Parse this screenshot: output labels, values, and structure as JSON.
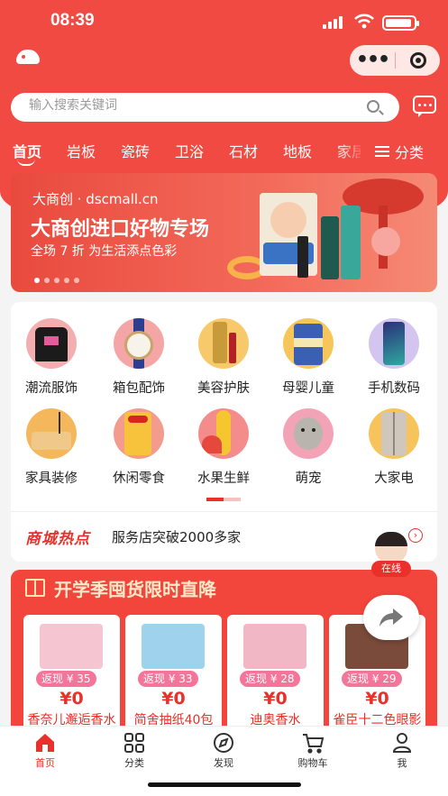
{
  "status_bar": {
    "time": "08:39"
  },
  "search": {
    "placeholder": "输入搜索关键词"
  },
  "tabs": [
    "首页",
    "岩板",
    "瓷砖",
    "卫浴",
    "石材",
    "地板",
    "家居"
  ],
  "category_button": "分类",
  "banner": {
    "brand": "大商创 · dscmall.cn",
    "title": "大商创进口好物专场",
    "subtitle": "全场 7 折 为生活添点色彩",
    "slides": 5,
    "active_slide": 1
  },
  "categories": [
    {
      "label": "潮流服饰",
      "icon": "tshirt-icon"
    },
    {
      "label": "箱包配饰",
      "icon": "watch-icon"
    },
    {
      "label": "美容护肤",
      "icon": "cosmetics-icon"
    },
    {
      "label": "母婴儿童",
      "icon": "formula-icon"
    },
    {
      "label": "手机数码",
      "icon": "phone-icon"
    },
    {
      "label": "家具装修",
      "icon": "sofa-icon"
    },
    {
      "label": "休闲零食",
      "icon": "snack-icon"
    },
    {
      "label": "水果生鲜",
      "icon": "corn-icon"
    },
    {
      "label": "萌宠",
      "icon": "cat-icon"
    },
    {
      "label": "大家电",
      "icon": "fridge-icon"
    }
  ],
  "hot": {
    "logo": "商城热点",
    "text": "服务店突破2000多家"
  },
  "online_service": "在线",
  "promo": {
    "title": "开学季囤货限时直降",
    "products": [
      {
        "rebate": "返现 ¥ 35",
        "price": "¥0",
        "name": "香奈儿邂逅香水",
        "color": "#f5c6d2"
      },
      {
        "rebate": "返现 ¥ 33",
        "price": "¥0",
        "name": "简舍抽纸40包",
        "color": "#9fd2ec"
      },
      {
        "rebate": "返现 ¥ 28",
        "price": "¥0",
        "name": "迪奥香水",
        "color": "#f2b7c4"
      },
      {
        "rebate": "返现 ¥ 29",
        "price": "¥0",
        "name": "雀臣十二色眼影",
        "color": "#7a4a3a"
      }
    ]
  },
  "tabbar": [
    {
      "label": "首页",
      "icon": "home-icon",
      "active": true
    },
    {
      "label": "分类",
      "icon": "grid-icon"
    },
    {
      "label": "发现",
      "icon": "compass-icon"
    },
    {
      "label": "购物车",
      "icon": "cart-icon"
    },
    {
      "label": "我",
      "icon": "user-icon"
    }
  ],
  "colors": {
    "brand": "#f04a42",
    "accent_red": "#e9302a",
    "rebate_pink": "#f4759a"
  }
}
